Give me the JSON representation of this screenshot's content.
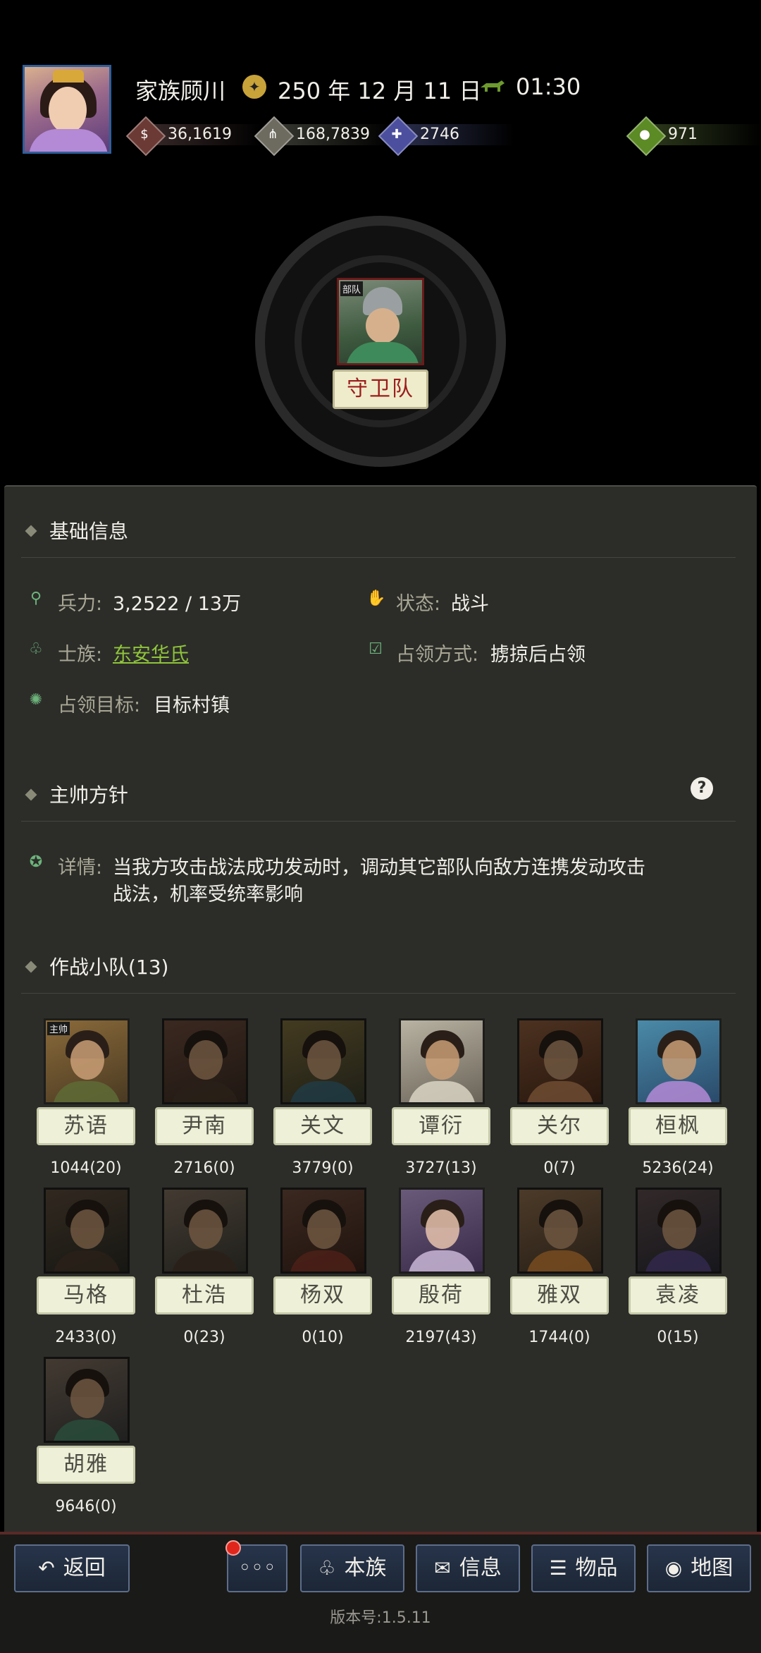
{
  "header": {
    "family_name": "家族顾川",
    "date": "250 年 12 月 11 日",
    "time": "01:30",
    "resources": [
      {
        "icon": "coin-icon",
        "value": "36,1619"
      },
      {
        "icon": "grain-icon",
        "value": "168,7839"
      },
      {
        "icon": "soldier-icon",
        "value": "2746"
      },
      {
        "icon": "money-bag-icon",
        "value": "971"
      }
    ]
  },
  "unit": {
    "tag": "部队",
    "name": "守卫队"
  },
  "basic_info": {
    "title": "基础信息",
    "troops_label": "兵力:",
    "troops_value": "3,2522 / 13万",
    "status_label": "状态:",
    "status_value": "战斗",
    "clan_label": "士族:",
    "clan_value": "东安华氏",
    "occupy_mode_label": "占领方式:",
    "occupy_mode_value": "掳掠后占领",
    "occupy_target_label": "占领目标:",
    "occupy_target_value": "目标村镇"
  },
  "strategy": {
    "title": "主帅方针",
    "help": "?",
    "detail_label": "详情:",
    "detail_line1": "当我方攻击战法成功发动时，调动其它部队向敌方连携发动攻击",
    "detail_line2": "战法，机率受统率影响"
  },
  "squad": {
    "title": "作战小队(13)",
    "leader_tag": "主帅",
    "members": [
      {
        "name": "苏语",
        "troops": "1044(20)"
      },
      {
        "name": "尹南",
        "troops": "2716(0)"
      },
      {
        "name": "关文",
        "troops": "3779(0)"
      },
      {
        "name": "谭衍",
        "troops": "3727(13)"
      },
      {
        "name": "关尔",
        "troops": "0(7)"
      },
      {
        "name": "桓枫",
        "troops": "5236(24)"
      },
      {
        "name": "马格",
        "troops": "2433(0)"
      },
      {
        "name": "杜浩",
        "troops": "0(23)"
      },
      {
        "name": "杨双",
        "troops": "0(10)"
      },
      {
        "name": "殷荷",
        "troops": "2197(43)"
      },
      {
        "name": "雅双",
        "troops": "1744(0)"
      },
      {
        "name": "袁凌",
        "troops": "0(15)"
      },
      {
        "name": "胡雅",
        "troops": "9646(0)"
      }
    ]
  },
  "bottom": {
    "back": "返回",
    "more": "◦◦◦",
    "clan": "本族",
    "info": "信息",
    "items": "物品",
    "map": "地图",
    "version": "版本号:1.5.11"
  },
  "colors": {
    "panel": "#2c2d29",
    "link": "#8fc43a",
    "unit_name": "#9b1d1d"
  }
}
